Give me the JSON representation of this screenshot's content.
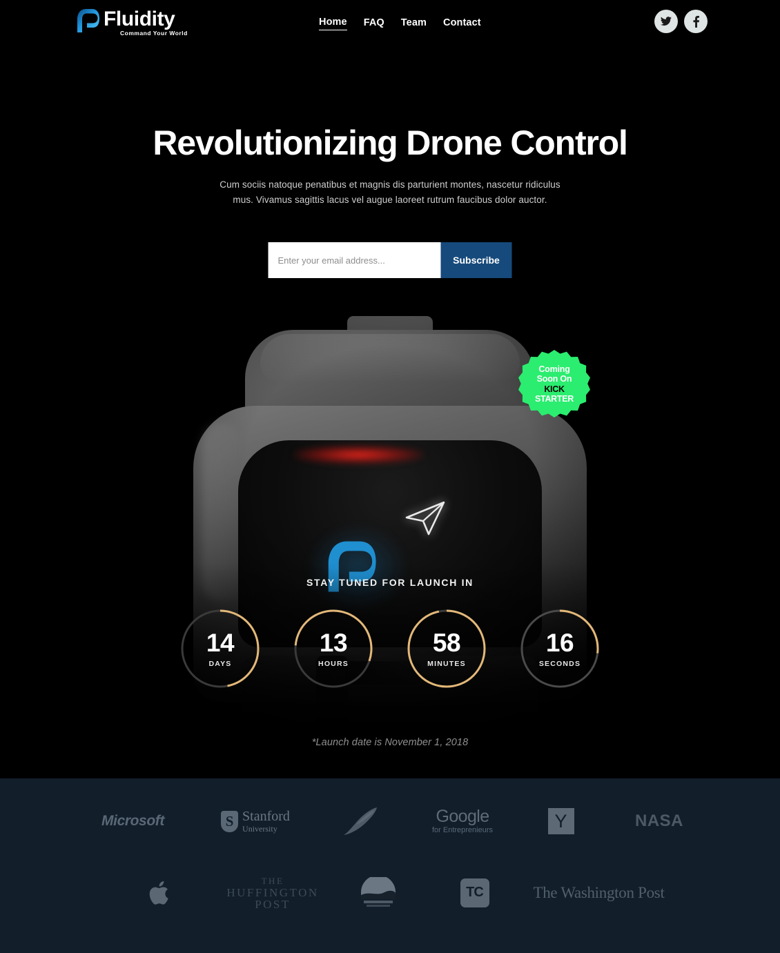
{
  "brand": {
    "name": "Fluidity",
    "tagline": "Command Your World",
    "logo_icon": "fluidity-f-mark",
    "logo_color": "#1f9ad6"
  },
  "nav": {
    "items": [
      {
        "label": "Home",
        "active": true
      },
      {
        "label": "FAQ",
        "active": false
      },
      {
        "label": "Team",
        "active": false
      },
      {
        "label": "Contact",
        "active": false
      }
    ]
  },
  "socials": [
    {
      "icon": "twitter-icon",
      "label": "Twitter"
    },
    {
      "icon": "facebook-icon",
      "label": "Facebook"
    }
  ],
  "hero": {
    "headline": "Revolutionizing Drone Control",
    "subcopy": "Cum sociis natoque penatibus et magnis dis parturient montes, nascetur ridiculus mus. Vivamus sagittis lacus vel augue laoreet rutrum faucibus dolor auctor."
  },
  "subscribe": {
    "placeholder": "Enter your email address...",
    "value": "",
    "button_label": "Subscribe",
    "button_color": "#164a7c"
  },
  "badge": {
    "line1": "Coming",
    "line2": "Soon On",
    "line3": "KICK",
    "line4": "STARTER",
    "color": "#2bed6f"
  },
  "product_image": {
    "device": "drone-controller",
    "screen_logo_icon": "fluidity-f-mark-glow",
    "screen_logo_color": "#1f8fd0",
    "screen_drone_icon": "paper-plane-icon",
    "indicator_light_color": "#ff2a1e"
  },
  "countdown": {
    "label": "STAY TUNED FOR LAUNCH IN",
    "ring_color": "#e3b878",
    "track_color": "#3a3a3a",
    "items": [
      {
        "value": "14",
        "unit": "DAYS",
        "progress": 0.47
      },
      {
        "value": "13",
        "unit": "HOURS",
        "progress": 0.54
      },
      {
        "value": "58",
        "unit": "MINUTES",
        "progress": 0.965
      },
      {
        "value": "16",
        "unit": "SECONDS",
        "progress": 0.27
      }
    ],
    "note": "*Launch date is November 1, 2018"
  },
  "footer": {
    "background": "#121f2b",
    "logos_row1": [
      {
        "name": "Microsoft",
        "icon": "microsoft-logo"
      },
      {
        "name": "Stanford University",
        "icon": "stanford-logo",
        "line1": "Stanford",
        "line2": "University"
      },
      {
        "name": "Feather",
        "icon": "feather-logo"
      },
      {
        "name": "Google for Entrepreneurs",
        "icon": "google-logo",
        "line1": "Google",
        "line2": "for Entreprenieurs"
      },
      {
        "name": "Y Combinator",
        "icon": "ycombinator-logo",
        "letter": "Y"
      },
      {
        "name": "NASA",
        "icon": "nasa-logo"
      }
    ],
    "logos_row2": [
      {
        "name": "Apple",
        "icon": "apple-logo"
      },
      {
        "name": "The Huffington Post",
        "icon": "huffington-post-logo",
        "line1": "THE",
        "line2": "HUFFINGTON",
        "line3": "POST"
      },
      {
        "name": "Trumbull",
        "icon": "trumbull-logo"
      },
      {
        "name": "TechCrunch",
        "icon": "techcrunch-logo",
        "letter": "TC"
      },
      {
        "name": "The Washington Post",
        "icon": "washington-post-logo",
        "label": "The Washington Post"
      }
    ]
  }
}
